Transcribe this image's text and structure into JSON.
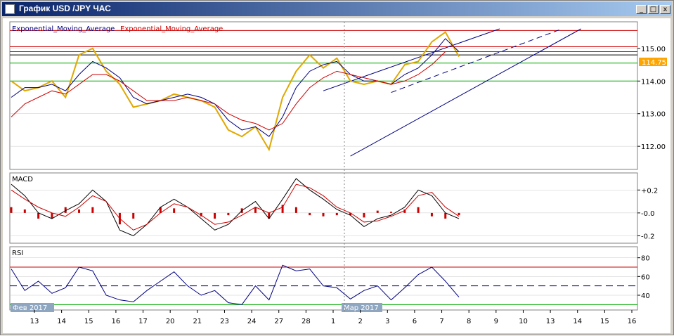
{
  "window": {
    "title": "График USD /JPY  ЧАС",
    "buttons": {
      "minimize": "_",
      "maximize": "□",
      "close": "x"
    }
  },
  "colors": {
    "background": "#ffffff",
    "price": "#e0a800",
    "ema_fast": "#000080",
    "ema_slow": "#cc0000",
    "channel": "#000080",
    "resistance": "#cc0000",
    "support": "#00aa00",
    "current_price_label_bg": "#ffa500",
    "macd_line": "#000000",
    "macd_signal": "#cc0000",
    "macd_hist": "#cc0000",
    "rsi_line": "#000080",
    "rsi_overbought_line": "#cc0000",
    "rsi_oversold_line": "#00aa00",
    "rsi_mid_line": "#000080",
    "grid": "#c8c8c8",
    "cursor_line": "#808080"
  },
  "chart_data": [
    {
      "type": "line",
      "panel": "price",
      "legend": [
        {
          "label": "Exponential_Moving_Average",
          "color": "#000080"
        },
        {
          "label": "Exponential_Moving_Average",
          "color": "#cc0000"
        }
      ],
      "current_price": "114.75",
      "ylim": [
        111.4,
        115.6
      ],
      "y_ticks": [
        "115.00",
        "114.00",
        "113.00",
        "112.00"
      ],
      "y_tick_values": [
        115.0,
        114.0,
        113.0,
        112.0
      ],
      "x": [
        0,
        0.5,
        1,
        1.5,
        2,
        2.5,
        3,
        3.5,
        4,
        4.5,
        5,
        5.5,
        6,
        6.5,
        7,
        7.5,
        8,
        8.5,
        9,
        9.5,
        10,
        10.5,
        11,
        11.5,
        12,
        12.5,
        13,
        13.5,
        14,
        14.5,
        15,
        15.5,
        16,
        16.5,
        17,
        17.5,
        18,
        18.5,
        19,
        19.5,
        20,
        20.5,
        21
      ],
      "series": [
        {
          "values": [
            114.0,
            113.7,
            113.8,
            114.0,
            113.5,
            114.8,
            115.0,
            114.3,
            113.9,
            113.2,
            113.3,
            113.4,
            113.6,
            113.5,
            113.4,
            113.2,
            112.5,
            112.3,
            112.6,
            111.9,
            113.5,
            114.3,
            114.8,
            114.4,
            114.7,
            114.0,
            113.9,
            114.0,
            113.9,
            114.5,
            114.6,
            115.2,
            115.5,
            114.75,
            114.75,
            114.75,
            114.75,
            114.75,
            114.75,
            114.75,
            114.75,
            114.75,
            114.75
          ]
        },
        {
          "values": [
            113.5,
            113.8,
            113.8,
            113.9,
            113.7,
            114.2,
            114.6,
            114.4,
            114.1,
            113.5,
            113.3,
            113.4,
            113.5,
            113.6,
            113.5,
            113.3,
            112.8,
            112.5,
            112.6,
            112.3,
            112.9,
            113.8,
            114.3,
            114.5,
            114.6,
            114.2,
            114.0,
            114.0,
            113.9,
            114.2,
            114.4,
            114.8,
            115.3,
            114.9,
            114.9,
            114.9,
            114.9,
            114.9,
            114.9,
            114.9,
            114.9,
            114.9,
            114.9
          ]
        },
        {
          "values": [
            112.9,
            113.3,
            113.5,
            113.7,
            113.6,
            113.9,
            114.2,
            114.2,
            114.0,
            113.7,
            113.4,
            113.4,
            113.4,
            113.5,
            113.4,
            113.3,
            113.0,
            112.8,
            112.7,
            112.5,
            112.7,
            113.3,
            113.8,
            114.1,
            114.3,
            114.2,
            114.1,
            114.0,
            113.9,
            114.0,
            114.2,
            114.5,
            114.9,
            114.9,
            114.9,
            114.9,
            114.9,
            114.9,
            114.9,
            114.9,
            114.9,
            114.9,
            114.9
          ]
        }
      ],
      "horizontal_levels": [
        {
          "value": 115.55,
          "color": "#cc0000"
        },
        {
          "value": 115.05,
          "color": "#cc0000"
        },
        {
          "value": 114.9,
          "color": "#cc0000"
        },
        {
          "value": 114.8,
          "color": "#000000"
        },
        {
          "value": 114.55,
          "color": "#00aa00"
        },
        {
          "value": 114.0,
          "color": "#00aa00"
        }
      ],
      "channel": {
        "upper": {
          "from": [
            11.5,
            113.7
          ],
          "to": [
            18.0,
            115.6
          ]
        },
        "middle": {
          "from": [
            14.0,
            113.65
          ],
          "to": [
            20.3,
            115.6
          ]
        },
        "lower": {
          "from": [
            12.5,
            111.7
          ],
          "to": [
            21.0,
            115.6
          ]
        }
      }
    },
    {
      "type": "bar",
      "panel": "macd",
      "title": "MACD",
      "ylim": [
        -0.24,
        0.3
      ],
      "y_ticks": [
        "+0.2",
        "-0.0",
        "-0.2"
      ],
      "y_tick_values": [
        0.2,
        0.0,
        -0.2
      ],
      "x": [
        0,
        0.5,
        1,
        1.5,
        2,
        2.5,
        3,
        3.5,
        4,
        4.5,
        5,
        5.5,
        6,
        6.5,
        7,
        7.5,
        8,
        8.5,
        9,
        9.5,
        10,
        10.5,
        11,
        11.5,
        12,
        12.5,
        13,
        13.5,
        14,
        14.5,
        15,
        15.5,
        16,
        16.5,
        17,
        17.5,
        18,
        18.5,
        19,
        19.5,
        20,
        20.5,
        21
      ],
      "series": [
        {
          "values": [
            0.25,
            0.15,
            0.0,
            -0.05,
            0.02,
            0.08,
            0.2,
            0.1,
            -0.15,
            -0.2,
            -0.1,
            0.05,
            0.12,
            0.05,
            -0.05,
            -0.15,
            -0.1,
            0.02,
            0.1,
            -0.05,
            0.12,
            0.3,
            0.2,
            0.12,
            0.03,
            -0.02,
            -0.12,
            -0.05,
            -0.02,
            0.05,
            0.2,
            0.15,
            0.0,
            -0.05,
            -0.05,
            -0.05,
            -0.05,
            -0.05,
            -0.05,
            -0.05,
            -0.05,
            -0.05,
            -0.05
          ]
        },
        {
          "values": [
            0.2,
            0.12,
            0.05,
            0.0,
            -0.03,
            0.05,
            0.15,
            0.1,
            -0.05,
            -0.15,
            -0.1,
            0.0,
            0.08,
            0.05,
            -0.02,
            -0.1,
            -0.08,
            -0.02,
            0.05,
            0.0,
            0.05,
            0.25,
            0.22,
            0.15,
            0.05,
            0.0,
            -0.08,
            -0.07,
            -0.03,
            0.02,
            0.15,
            0.18,
            0.05,
            -0.03,
            -0.03,
            -0.03,
            -0.03,
            -0.03,
            -0.03,
            -0.03,
            -0.03,
            -0.03,
            -0.03
          ]
        }
      ]
    },
    {
      "type": "line",
      "panel": "rsi",
      "title": "RSI",
      "ylim": [
        28,
        88
      ],
      "y_ticks": [
        "80",
        "60",
        "40"
      ],
      "y_tick_values": [
        80,
        60,
        40
      ],
      "levels": [
        70,
        50,
        30
      ],
      "x": [
        0,
        0.5,
        1,
        1.5,
        2,
        2.5,
        3,
        3.5,
        4,
        4.5,
        5,
        5.5,
        6,
        6.5,
        7,
        7.5,
        8,
        8.5,
        9,
        9.5,
        10,
        10.5,
        11,
        11.5,
        12,
        12.5,
        13,
        13.5,
        14,
        14.5,
        15,
        15.5,
        16,
        16.5,
        17,
        17.5,
        18,
        18.5,
        19,
        19.5,
        20,
        20.5,
        21
      ],
      "series": [
        {
          "values": [
            68,
            45,
            55,
            42,
            48,
            70,
            66,
            40,
            35,
            33,
            45,
            55,
            65,
            50,
            40,
            45,
            32,
            30,
            50,
            35,
            72,
            66,
            68,
            50,
            48,
            36,
            45,
            50,
            35,
            48,
            62,
            70,
            55,
            38,
            38,
            38,
            38,
            38,
            38,
            38,
            38,
            38,
            38
          ]
        }
      ]
    }
  ],
  "x_axis": {
    "labels": [
      "13",
      "14",
      "15",
      "16",
      "17",
      "20",
      "21",
      "23",
      "24",
      "27",
      "28",
      "1",
      "2",
      "3",
      "6",
      "7",
      "8",
      "9",
      "10",
      "13",
      "14",
      "15",
      "16"
    ],
    "period_labels": [
      "Фев 2017",
      "Мар 2017"
    ]
  }
}
